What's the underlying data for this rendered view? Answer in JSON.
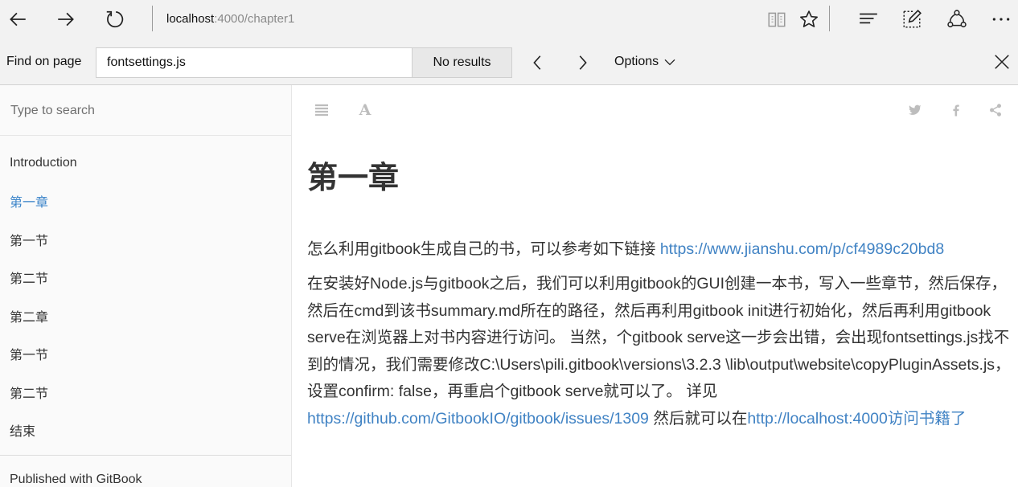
{
  "browser": {
    "url_host": "localhost",
    "url_rest": ":4000/chapter1",
    "icons": {
      "back": "back-arrow-icon",
      "forward": "forward-arrow-icon",
      "refresh": "refresh-icon",
      "reading_view": "reading-view-icon",
      "favorite": "star-icon",
      "hub": "hub-icon",
      "web_note": "web-note-icon",
      "share": "share-icon",
      "more": "more-icon"
    }
  },
  "find_bar": {
    "label": "Find on page",
    "query": "fontsettings.js",
    "status": "No results",
    "options_label": "Options"
  },
  "sidebar": {
    "search_placeholder": "Type to search",
    "items": [
      {
        "label": "Introduction",
        "active": false
      },
      {
        "label": "第一章",
        "active": true
      },
      {
        "label": "第一节",
        "active": false
      },
      {
        "label": "第二节",
        "active": false
      },
      {
        "label": "第二章",
        "active": false
      },
      {
        "label": "第一节",
        "active": false
      },
      {
        "label": "第二节",
        "active": false
      },
      {
        "label": "结束",
        "active": false
      }
    ],
    "published": "Published with GitBook"
  },
  "content": {
    "title": "第一章",
    "p1_text": "怎么利用gitbook生成自己的书，可以参考如下链接 ",
    "p1_link": "https://www.jianshu.com/p/cf4989c20bd8",
    "p2_text": "在安装好Node.js与gitbook之后，我们可以利用gitbook的GUI创建一本书，写入一些章节，然后保存，然后在cmd到该书summary.md所在的路径，然后再利用gitbook init进行初始化，然后再利用gitbook serve在浏览器上对书内容进行访问。 当然，个gitbook serve这一步会出错，会出现fontsettings.js找不到的情况，我们需要修改C:\\Users\\pili.gitbook\\versions\\3.2.3 \\lib\\output\\website\\copyPluginAssets.js，设置confirm: false，再重启个gitbook serve就可以了。 详见",
    "p2_link1": "https://github.com/GitbookIO/gitbook/issues/1309",
    "p2_mid": " 然后就可以在",
    "p2_link2": "http://localhost:4000访问书籍了",
    "font_icon_glyph": "A",
    "accent_color": "#4183c4"
  }
}
